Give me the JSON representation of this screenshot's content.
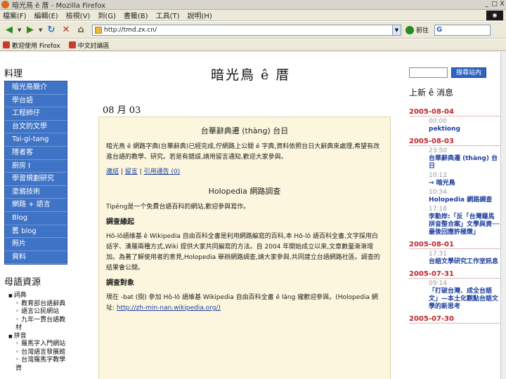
{
  "window": {
    "title": "暗光鳥 ê 厝 - Mozilla Firefox",
    "buttons": [
      "_",
      "□",
      "X"
    ]
  },
  "menubar": {
    "items": [
      "檔案(F)",
      "編輯(E)",
      "檢視(V)",
      "到(G)",
      "書籤(B)",
      "工具(T)",
      "說明(H)"
    ]
  },
  "navbar": {
    "url": "http://tmd.zx.cn/",
    "go_label": "前往",
    "search_placeholder": "G"
  },
  "bookmarks": {
    "items": [
      {
        "label": "歡迎使用 Firefox",
        "icon": "firefox-icon"
      },
      {
        "label": "中文討論區",
        "icon": "bookmark-icon"
      }
    ]
  },
  "sidebar": {
    "menu_title": "料理",
    "menu_items": [
      "暗光鳥簡介",
      "學台語",
      "工程師仔",
      "台文的文學",
      "Tai-gi-tang",
      "隱者客",
      "廚房 I",
      "學習規劃研究",
      "塗鴉技術",
      "網路 + 語言",
      "Blog",
      "舊 blog",
      "照片",
      "資料"
    ],
    "resources_title": "母語資源",
    "resources": [
      {
        "level": 1,
        "text": "詞典"
      },
      {
        "level": 2,
        "text": "教育部台語辭典"
      },
      {
        "level": 2,
        "text": "語言公民網站"
      },
      {
        "level": 2,
        "text": "九年一貫台語教材"
      },
      {
        "level": 1,
        "text": "拼音"
      },
      {
        "level": 2,
        "text": "羅馬字入門網站"
      },
      {
        "level": 2,
        "text": "台灣語言發展館"
      },
      {
        "level": 2,
        "text": "台灣羅馬字教學資"
      }
    ]
  },
  "main": {
    "site_title": "暗光鳥 ê 厝",
    "date_heading": "08 月 03",
    "post": {
      "title": "台華辭典遷 (thàng) 台日",
      "intro": "暗光鳥 ê 網路字典(台華辭典)已經完成,佇網路上公開 ê 字典,資料依照台日大辭典來處理,希望有改進台語的教學、研究。若是有錯誤,請用留言通知,歡迎大家參與。",
      "meta_links": [
        "連結",
        "留言",
        "引用通告 (0)"
      ],
      "section1_title": "Holopedia 網路調查",
      "section1_text": "Tipēng是一个免費台語百科的網站,歡迎參與寫作。",
      "section2_title": "調查緣起",
      "section2_text": "Hô-lô語維基 ê Wikipedia 自由百科全書是利用網路編寫的百科,本 Hô-lô 語百科全書,文字採用白話字、漢羅兩種方式,Wiki 提供大家共同編寫的方法。自 2004 年開始成立以來,文章數量漸漸增加。為著了解使用者的意見,Holopedia 舉辦網路調查,請大家參與,共同建立台語網路社區。調查的結果會公開。",
      "section3_title": "調查對象",
      "section3_text": "現在 -bat (捌) 參加 Hô-lô 語維基 Wikipedia 自由百科全書 ê lâng 攏歡迎參與。(Holopedia 網址:",
      "section3_link": "http://zh-min-nan.wikipedia.org/)"
    }
  },
  "rightcol": {
    "search_button": "搜尋站內",
    "recent_title": "上新 ê 消息",
    "entries": [
      {
        "date": "2005-08-04",
        "items": [
          {
            "time": "00:00",
            "text": "pektiong"
          }
        ]
      },
      {
        "date": "2005-08-03",
        "items": [
          {
            "time": "23:50",
            "text": "台華辭典遷 (thàng) 台日"
          },
          {
            "time": "10:12",
            "text": "→ 暗光鳥"
          },
          {
            "time": "10:34",
            "text": "Holopedia 網路調查"
          },
          {
            "time": "17:18",
            "text": "李勤岸:「反「台灣羅馬拼音整合案」文學與資──最後回應許極燉」"
          }
        ]
      },
      {
        "date": "2005-08-01",
        "items": [
          {
            "time": "17:31",
            "text": "台語文學研究工作室訊息"
          }
        ]
      },
      {
        "date": "2005-07-31",
        "items": [
          {
            "time": "09:14",
            "text": "「打破台灣、成全台語文」—本土化觀點台語文學的新思考"
          }
        ]
      },
      {
        "date": "2005-07-30",
        "items": []
      }
    ]
  }
}
